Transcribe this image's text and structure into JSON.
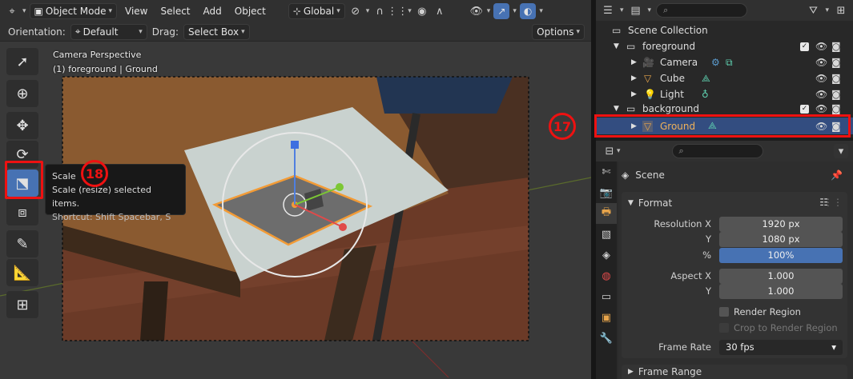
{
  "viewport_header": {
    "mode": "Object Mode",
    "menus": [
      "View",
      "Select",
      "Add",
      "Object"
    ],
    "transform_orientation": "Global"
  },
  "tool_header": {
    "orientation_label": "Orientation:",
    "orientation_value": "Default",
    "drag_label": "Drag:",
    "drag_value": "Select Box",
    "options_label": "Options"
  },
  "viewport_overlay": {
    "view_name": "Camera Perspective",
    "context": "(1) foreground | Ground"
  },
  "tooltip": {
    "title": "Scale",
    "description": "Scale (resize) selected items.",
    "shortcut": "Shortcut: Shift Spacebar, S"
  },
  "callouts": {
    "scale_tool": "18",
    "ground_row": "17"
  },
  "outliner": {
    "root": "Scene Collection",
    "rows": [
      {
        "name": "foreground",
        "type": "collection"
      },
      {
        "name": "Camera",
        "type": "camera"
      },
      {
        "name": "Cube",
        "type": "mesh"
      },
      {
        "name": "Light",
        "type": "light"
      },
      {
        "name": "background",
        "type": "collection"
      },
      {
        "name": "Ground",
        "type": "mesh",
        "selected": true
      }
    ]
  },
  "properties": {
    "context_title": "Scene",
    "panel_format": "Format",
    "resolution_x_label": "Resolution X",
    "resolution_x": "1920 px",
    "resolution_y_label": "Y",
    "resolution_y": "1080 px",
    "percent_label": "%",
    "percent": "100%",
    "aspect_x_label": "Aspect X",
    "aspect_x": "1.000",
    "aspect_y_label": "Y",
    "aspect_y": "1.000",
    "render_region": "Render Region",
    "crop_region": "Crop to Render Region",
    "frame_rate_label": "Frame Rate",
    "frame_rate": "30 fps",
    "panel_frame_range": "Frame Range"
  },
  "colors": {
    "selection_blue": "#4772b3",
    "highlight_red": "#ee1111",
    "outline_orange": "#f29b36"
  }
}
